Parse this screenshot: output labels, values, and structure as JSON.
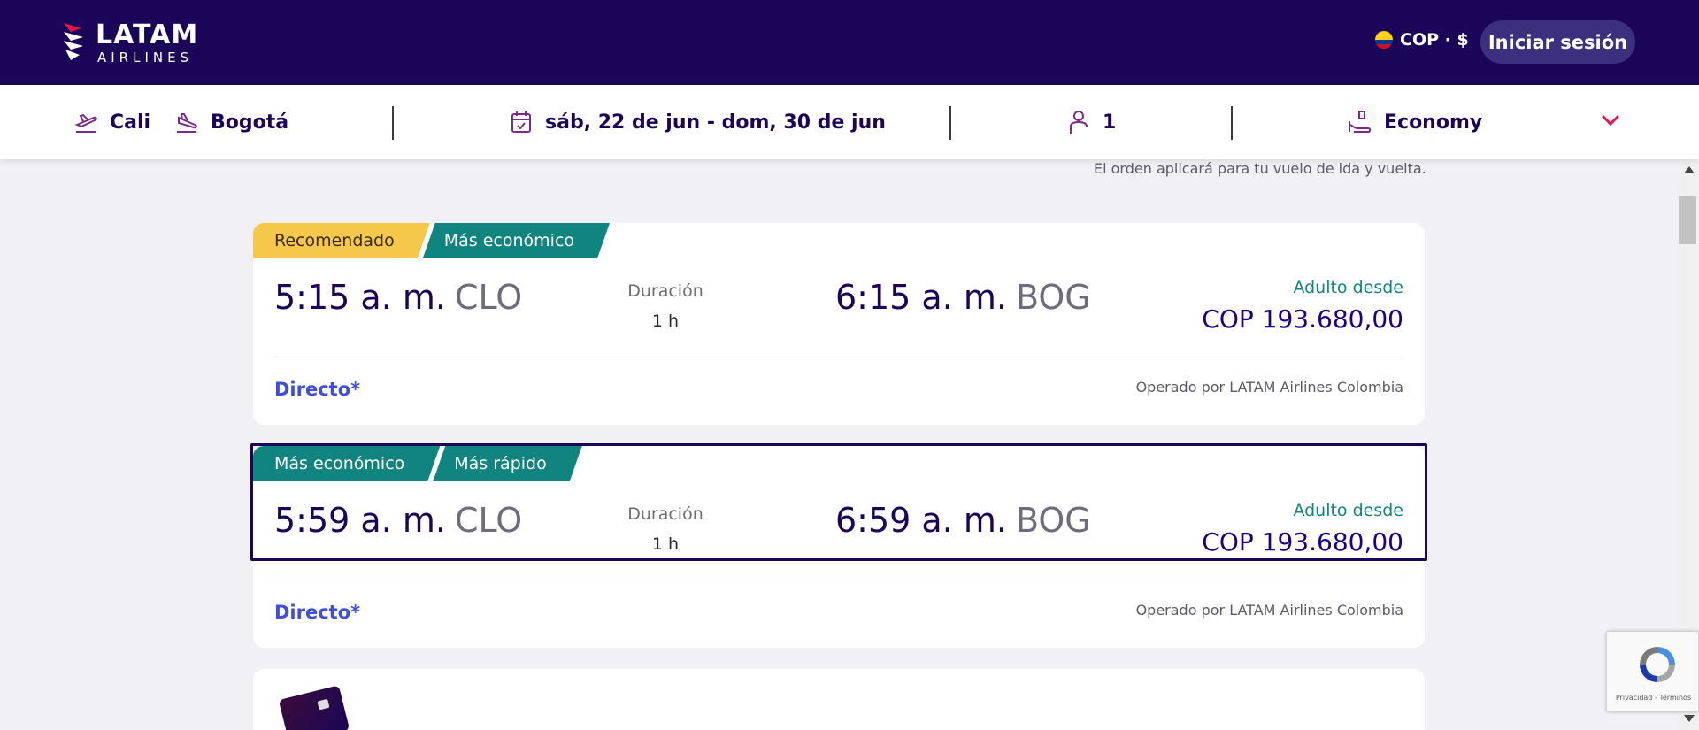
{
  "header": {
    "logo_top": "LATAM",
    "logo_bottom": "AIRLINES",
    "currency": "COP · $",
    "login_label": "Iniciar sesión"
  },
  "search": {
    "origin": "Cali",
    "destination": "Bogotá",
    "dates": "sáb, 22 de jun - dom, 30 de jun",
    "passengers": "1",
    "cabin": "Economy"
  },
  "sort_note": "El orden aplicará para tu vuelo de ida y vuelta.",
  "flights": [
    {
      "tags": [
        "Recomendado",
        "Más económico"
      ],
      "depart_time": "5:15 a. m.",
      "depart_code": "CLO",
      "duration_label": "Duración",
      "duration": "1 h",
      "arrive_time": "6:15 a. m.",
      "arrive_code": "BOG",
      "price_label": "Adulto desde",
      "price": "COP 193.680,00",
      "stops": "Directo*",
      "operator": "Operado por LATAM Airlines Colombia"
    },
    {
      "tags": [
        "Más económico",
        "Más rápido"
      ],
      "depart_time": "5:59 a. m.",
      "depart_code": "CLO",
      "duration_label": "Duración",
      "duration": "1 h",
      "arrive_time": "6:59 a. m.",
      "arrive_code": "BOG",
      "price_label": "Adulto desde",
      "price": "COP 193.680,00",
      "stops": "Directo*",
      "operator": "Operado por LATAM Airlines Colombia"
    }
  ],
  "recaptcha": {
    "text": "Privacidad - Términos"
  },
  "colors": {
    "header_bg": "#1b0558",
    "tag_yellow": "#f5c84c",
    "tag_green": "#10847e",
    "price_blue": "#1b0088",
    "link_blue": "#3f4fd9"
  }
}
